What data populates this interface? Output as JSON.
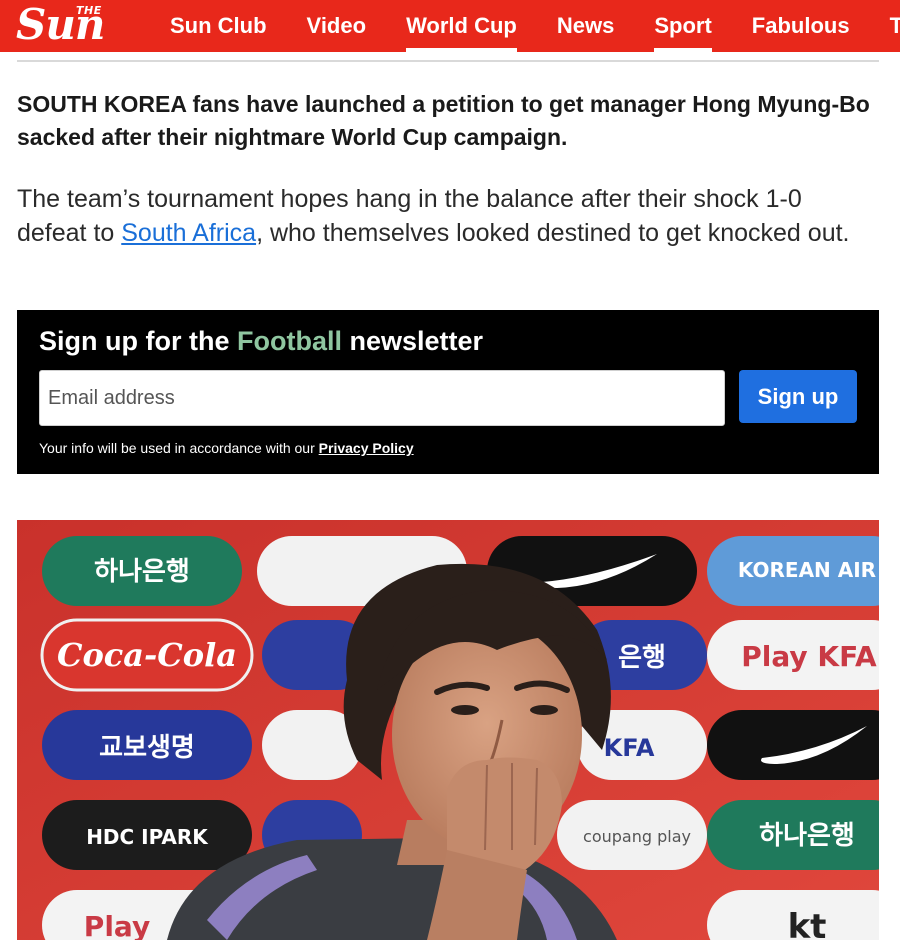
{
  "header": {
    "logo_small": "THE",
    "logo_main": "Sun",
    "nav": [
      {
        "label": "Sun Club",
        "active": false
      },
      {
        "label": "Video",
        "active": false
      },
      {
        "label": "World Cup",
        "active": true
      },
      {
        "label": "News",
        "active": false
      },
      {
        "label": "Sport",
        "active": true
      },
      {
        "label": "Fabulous",
        "active": false
      },
      {
        "label": "TV",
        "active": false
      }
    ]
  },
  "article": {
    "lead": "SOUTH KOREA fans have launched a petition to get manager Hong Myung-Bo sacked after their nightmare World Cup campaign.",
    "para_before": "The team’s tournament hopes hang in the balance after their shock 1-0 defeat to ",
    "para_link": "South Africa",
    "para_after": ", who themselves looked destined to get knocked out."
  },
  "newsletter": {
    "title_before": "Sign up for the ",
    "title_accent": "Football",
    "title_after": " newsletter",
    "email_placeholder": "Email address",
    "button_label": "Sign up",
    "note_before": "Your info will be used in accordance with our ",
    "privacy_link": "Privacy Policy"
  },
  "photo": {
    "sponsor_board": {
      "row1": [
        "하나은행",
        "",
        "",
        "KOREAN AIR"
      ],
      "row2": [
        "Coca-Cola",
        "",
        "은행",
        "Play KFA"
      ],
      "row3": [
        "교보생명",
        "",
        "KFA",
        ""
      ],
      "row4": [
        "HDC IPARK",
        "",
        "coupang play",
        "하나은행"
      ],
      "row5": [
        "Play",
        "",
        "",
        "kt"
      ]
    }
  },
  "colors": {
    "brand_red": "#e8281b",
    "link_blue": "#1a6fd8",
    "newsletter_bg": "#000000",
    "newsletter_accent": "#8fc6a0",
    "button_blue": "#1f6fe0"
  }
}
